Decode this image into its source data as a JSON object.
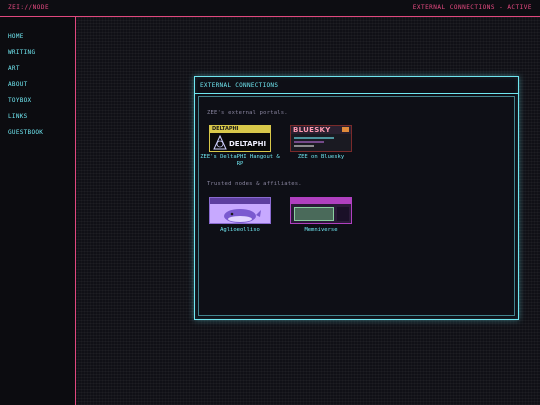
{
  "header": {
    "site_name": "ZEI://NODE",
    "status": "EXTERNAL CONNECTIONS - ACTIVE"
  },
  "sidebar": {
    "items": [
      {
        "label": "HOME"
      },
      {
        "label": "WRITING"
      },
      {
        "label": "ART"
      },
      {
        "label": "ABOUT"
      },
      {
        "label": "TOYBOX"
      },
      {
        "label": "LINKS"
      },
      {
        "label": "GUESTBOOK"
      }
    ]
  },
  "window": {
    "title": "EXTERNAL CONNECTIONS",
    "intro": "ZEE's external portals.",
    "affiliates_heading": "Trusted nodes & affiliates."
  },
  "portals": [
    {
      "caption": "ZEE's DeltaPHI Hangout & RP",
      "button_text": "DELTAPHI",
      "banner_text": "DELTAPHI",
      "icon": "deltaphi-sigil-icon"
    },
    {
      "caption": "ZEE on Bluesky",
      "button_text": "BLUESKY",
      "icon": "bluesky-button-icon"
    }
  ],
  "affiliates": [
    {
      "caption": "Aglioeolliso",
      "icon": "whale-button-icon"
    },
    {
      "caption": "Memniverse",
      "icon": "memniverse-button-icon"
    }
  ],
  "colors": {
    "accent_pink": "#e84a82",
    "accent_cyan": "#6fe6f0",
    "background": "#101016"
  }
}
